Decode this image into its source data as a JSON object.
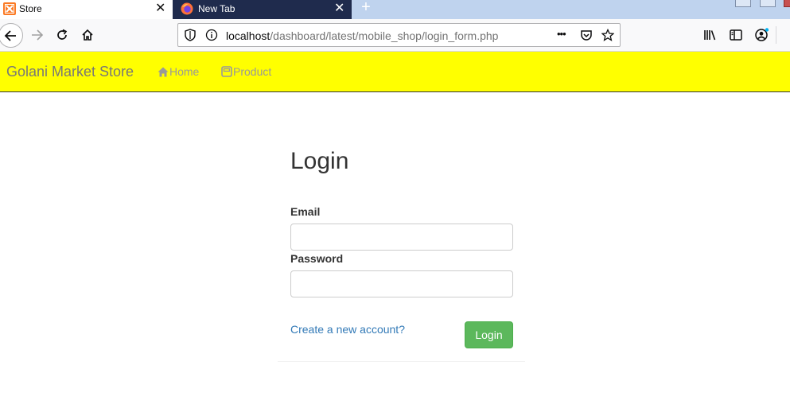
{
  "browser": {
    "tabs": [
      {
        "title": "Store",
        "active": true
      },
      {
        "title": "New Tab",
        "active": false
      }
    ],
    "new_tab_glyph": "+",
    "close_glyph": "✕",
    "url_host": "localhost",
    "url_path": "/dashboard/latest/mobile_shop/login_form.php",
    "more_glyph": "•••",
    "icons": [
      "back-icon",
      "forward-icon",
      "reload-icon",
      "home-icon",
      "shield-icon",
      "info-icon",
      "pocket-icon",
      "bookmark-star-icon",
      "library-icon",
      "sidebar-icon",
      "account-icon"
    ]
  },
  "site": {
    "brand": "Golani Market Store",
    "nav": [
      {
        "label": "Home",
        "icon": "home-icon"
      },
      {
        "label": "Product",
        "icon": "product-icon"
      }
    ],
    "colors": {
      "navbar": "#ffff00",
      "button": "#5cb85c",
      "link": "#337ab7"
    }
  },
  "login": {
    "title": "Login",
    "email_label": "Email",
    "email_value": "",
    "password_label": "Password",
    "password_value": "",
    "create_account": "Create a new account?",
    "submit_label": "Login"
  }
}
